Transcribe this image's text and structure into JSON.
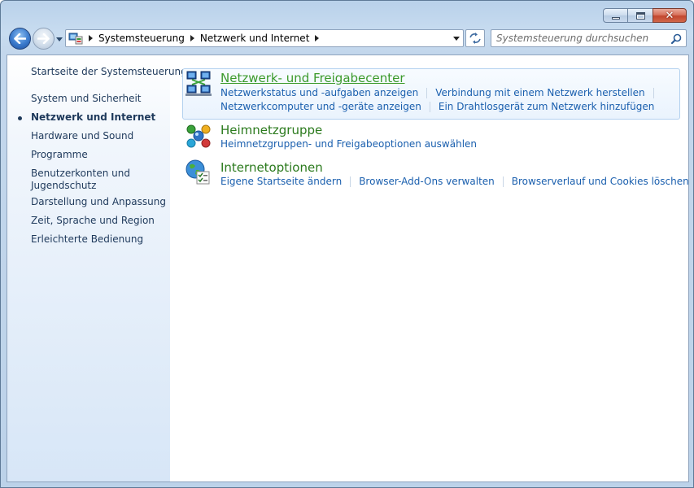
{
  "window": {
    "controls": {
      "minimize": "minimize",
      "maximize": "maximize",
      "close": "close"
    }
  },
  "address": {
    "crumbs": [
      "Systemsteuerung",
      "Netzwerk und Internet"
    ]
  },
  "search": {
    "placeholder": "Systemsteuerung durchsuchen"
  },
  "sidebar": {
    "home": "Startseite der Systemsteuerung",
    "items": [
      {
        "label": "System und Sicherheit",
        "active": false
      },
      {
        "label": "Netzwerk und Internet",
        "active": true
      },
      {
        "label": "Hardware und Sound",
        "active": false
      },
      {
        "label": "Programme",
        "active": false
      },
      {
        "label": "Benutzerkonten und Jugendschutz",
        "active": false
      },
      {
        "label": "Darstellung und Anpassung",
        "active": false
      },
      {
        "label": "Zeit, Sprache und Region",
        "active": false
      },
      {
        "label": "Erleichterte Bedienung",
        "active": false
      }
    ]
  },
  "categories": [
    {
      "title": "Netzwerk- und Freigabecenter",
      "icon": "network-center-icon",
      "tasks_row1": [
        "Netzwerkstatus und -aufgaben anzeigen",
        "Verbindung mit einem Netzwerk herstellen"
      ],
      "tasks_row2": [
        "Netzwerkcomputer und -geräte anzeigen",
        "Ein Drahtlosgerät zum Netzwerk hinzufügen"
      ]
    },
    {
      "title": "Heimnetzgruppe",
      "icon": "homegroup-icon",
      "tasks_row1": [
        "Heimnetzgruppen- und Freigabeoptionen auswählen"
      ]
    },
    {
      "title": "Internetoptionen",
      "icon": "internet-options-icon",
      "tasks_row1": [
        "Eigene Startseite ändern",
        "Browser-Add-Ons verwalten",
        "Browserverlauf und Cookies löschen"
      ]
    }
  ],
  "colors": {
    "link": "#1a5fae",
    "category_title": "#2b7a1d",
    "sidebar_text": "#1e395b"
  }
}
